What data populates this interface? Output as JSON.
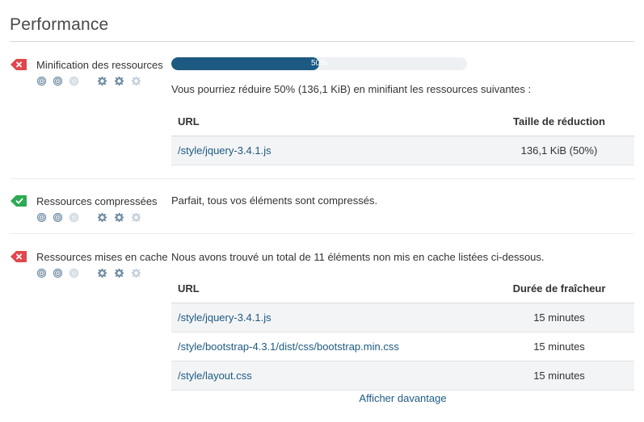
{
  "page": {
    "title": "Performance"
  },
  "colors": {
    "accent": "#1d5a82",
    "fail": "#e0474c",
    "pass": "#2daa53",
    "progress_track": "#eef1f4"
  },
  "rules": [
    {
      "name": "Minification des ressources",
      "status": "fail",
      "status_icon": "x-mark-icon",
      "progress": {
        "percent": 50,
        "label": "50%"
      },
      "description": "Vous pourriez réduire 50% (136,1 KiB) en minifiant les ressources suivantes :",
      "table": {
        "headers": [
          "URL",
          "Taille de réduction"
        ],
        "rows": [
          {
            "url": "/style/jquery-3.4.1.js",
            "value": "136,1 KiB (50%)"
          }
        ]
      }
    },
    {
      "name": "Ressources compressées",
      "status": "pass",
      "status_icon": "check-mark-icon",
      "description": "Parfait, tous vos éléments sont compressés."
    },
    {
      "name": "Ressources mises en cache",
      "status": "fail",
      "status_icon": "x-mark-icon",
      "description": "Nous avons trouvé un total de 11 éléments non mis en cache listées ci-dessous.",
      "table": {
        "headers": [
          "URL",
          "Durée de fraîcheur"
        ],
        "rows": [
          {
            "url": "/style/jquery-3.4.1.js",
            "value": "15 minutes"
          },
          {
            "url": "/style/bootstrap-4.3.1/dist/css/bootstrap.min.css",
            "value": "15 minutes"
          },
          {
            "url": "/style/layout.css",
            "value": "15 minutes"
          }
        ]
      },
      "more_link": "Afficher davantage"
    }
  ],
  "indicators": {
    "difficulty": {
      "icon": "target-icon",
      "level": 2,
      "max": 3
    },
    "impact": {
      "icon": "gear-icon",
      "level": 2,
      "max": 3
    }
  }
}
